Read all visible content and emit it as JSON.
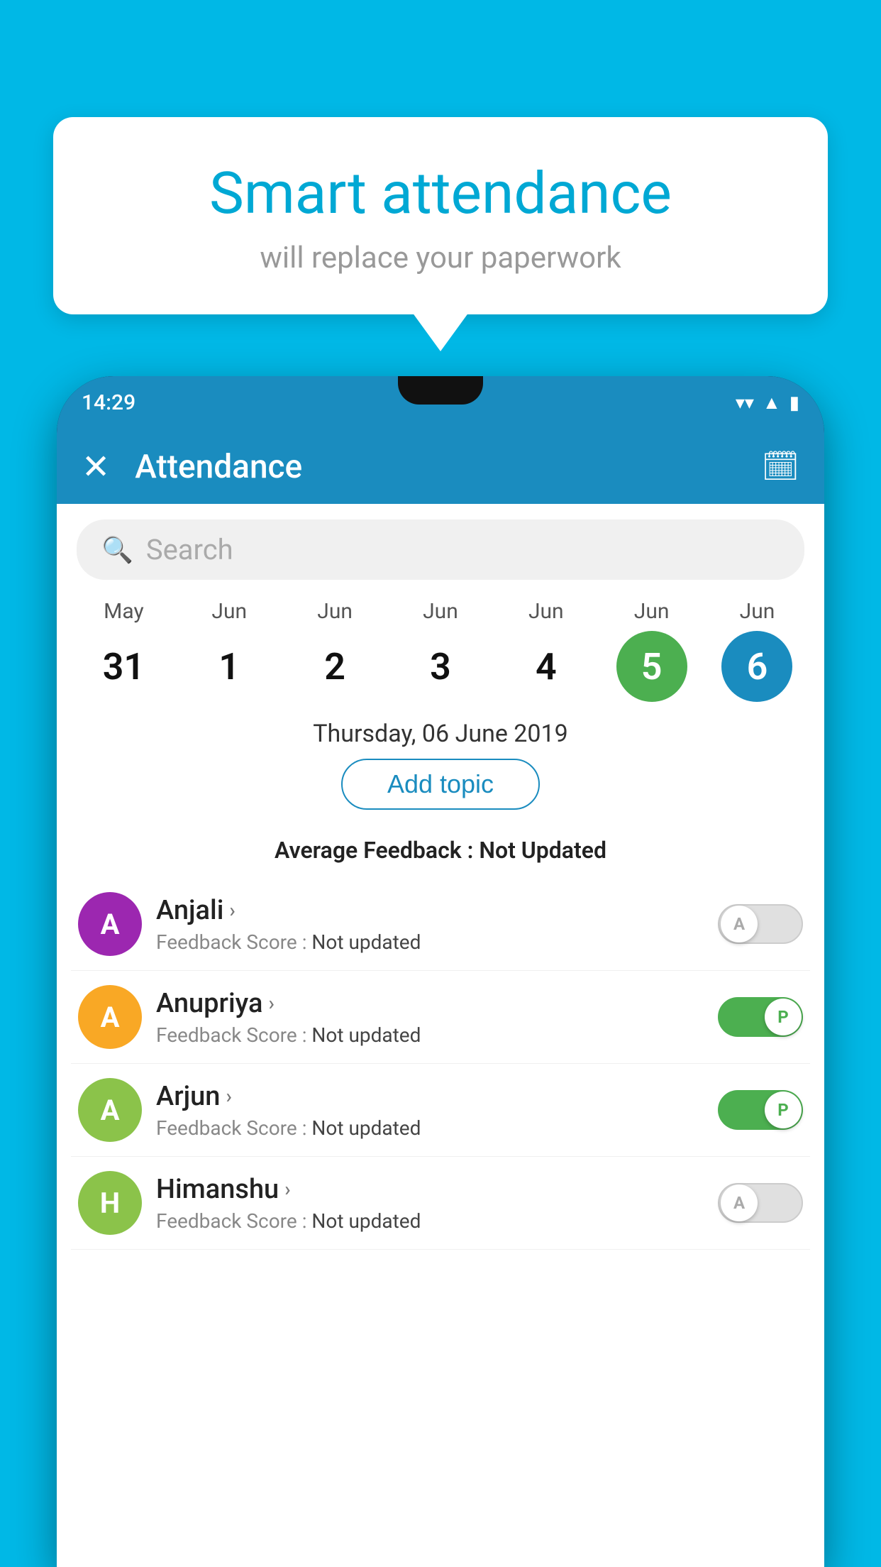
{
  "background": {
    "color": "#00b8e6"
  },
  "bubble": {
    "title": "Smart attendance",
    "subtitle": "will replace your paperwork"
  },
  "status_bar": {
    "time": "14:29",
    "wifi_icon": "▼",
    "signal_icon": "◀",
    "battery_icon": "▮"
  },
  "app_header": {
    "close_label": "✕",
    "title": "Attendance",
    "calendar_icon": "📅"
  },
  "search": {
    "placeholder": "Search"
  },
  "calendar": {
    "days": [
      {
        "month": "May",
        "date": "31",
        "style": "normal"
      },
      {
        "month": "Jun",
        "date": "1",
        "style": "normal"
      },
      {
        "month": "Jun",
        "date": "2",
        "style": "normal"
      },
      {
        "month": "Jun",
        "date": "3",
        "style": "normal"
      },
      {
        "month": "Jun",
        "date": "4",
        "style": "normal"
      },
      {
        "month": "Jun",
        "date": "5",
        "style": "today"
      },
      {
        "month": "Jun",
        "date": "6",
        "style": "selected"
      }
    ]
  },
  "selected_date": "Thursday, 06 June 2019",
  "add_topic_label": "Add topic",
  "avg_feedback": {
    "label": "Average Feedback : ",
    "value": "Not Updated"
  },
  "students": [
    {
      "name": "Anjali",
      "initial": "A",
      "avatar_color": "#9c27b0",
      "feedback_label": "Feedback Score : ",
      "feedback_value": "Not updated",
      "attendance": "absent",
      "toggle_label": "A"
    },
    {
      "name": "Anupriya",
      "initial": "A",
      "avatar_color": "#f9a825",
      "feedback_label": "Feedback Score : ",
      "feedback_value": "Not updated",
      "attendance": "present",
      "toggle_label": "P"
    },
    {
      "name": "Arjun",
      "initial": "A",
      "avatar_color": "#8bc34a",
      "feedback_label": "Feedback Score : ",
      "feedback_value": "Not updated",
      "attendance": "present",
      "toggle_label": "P"
    },
    {
      "name": "Himanshu",
      "initial": "H",
      "avatar_color": "#8bc34a",
      "feedback_label": "Feedback Score : ",
      "feedback_value": "Not updated",
      "attendance": "absent",
      "toggle_label": "A"
    }
  ]
}
